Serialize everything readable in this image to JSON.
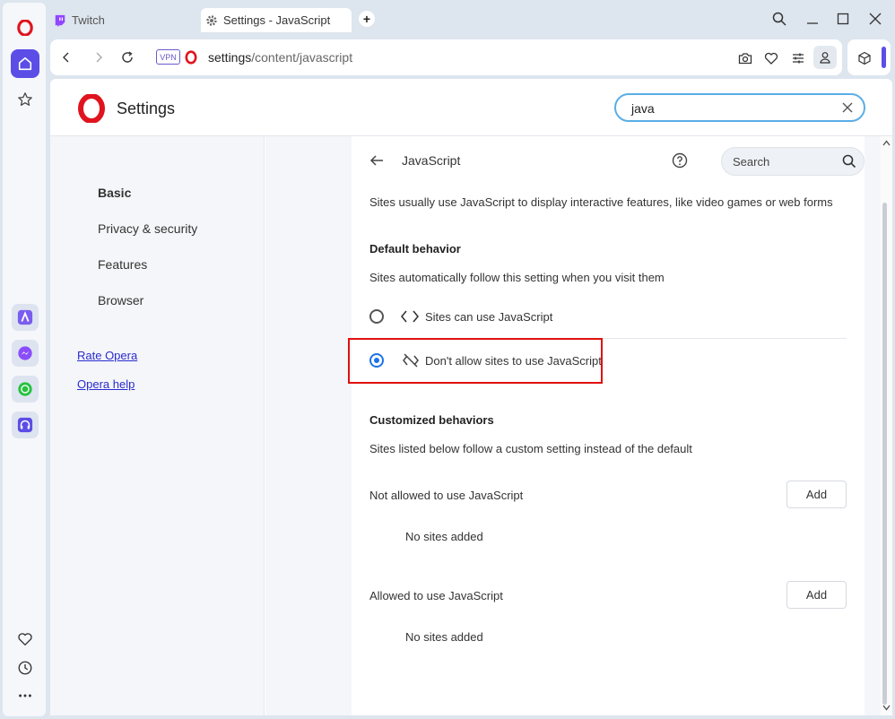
{
  "tabs": [
    {
      "label": "Twitch"
    },
    {
      "label": "Settings - JavaScript"
    }
  ],
  "address": {
    "vpn": "VPN",
    "host": "settings",
    "path": "/content/javascript"
  },
  "header": {
    "title": "Settings",
    "search_value": "java"
  },
  "sidebar": {
    "items": [
      {
        "label": "Basic"
      },
      {
        "label": "Privacy & security"
      },
      {
        "label": "Features"
      },
      {
        "label": "Browser"
      }
    ],
    "links": [
      {
        "label": "Rate Opera"
      },
      {
        "label": "Opera help"
      }
    ]
  },
  "panel": {
    "title": "JavaScript",
    "search_placeholder": "Search",
    "description": "Sites usually use JavaScript to display interactive features, like video games or web forms",
    "default_heading": "Default behavior",
    "default_sub": "Sites automatically follow this setting when you visit them",
    "options": [
      {
        "label": "Sites can use JavaScript",
        "selected": false
      },
      {
        "label": "Don't allow sites to use JavaScript",
        "selected": true
      }
    ],
    "custom_heading": "Customized behaviors",
    "custom_sub": "Sites listed below follow a custom setting instead of the default",
    "not_allowed": {
      "label": "Not allowed to use JavaScript",
      "button": "Add",
      "empty": "No sites added"
    },
    "allowed": {
      "label": "Allowed to use JavaScript",
      "button": "Add",
      "empty": "No sites added"
    }
  },
  "colors": {
    "accent": "#1a73e8",
    "highlight": "#e01010",
    "opera_red": "#e0141e",
    "sidebar_accent": "#5b4de6"
  }
}
